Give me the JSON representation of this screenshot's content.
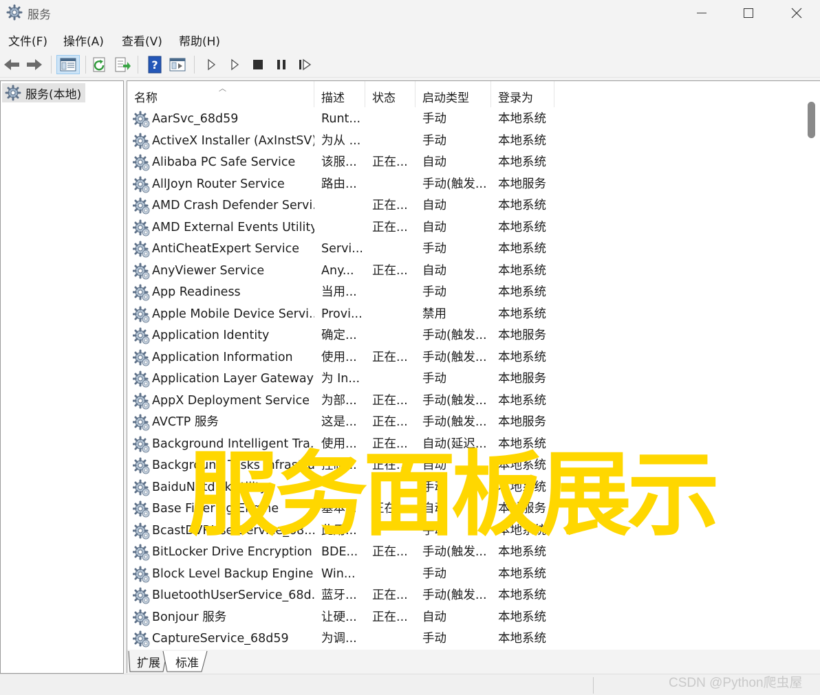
{
  "window": {
    "title": "服务",
    "icon": "gear-icon"
  },
  "menu": [
    {
      "label": "文件(F)"
    },
    {
      "label": "操作(A)"
    },
    {
      "label": "查看(V)"
    },
    {
      "label": "帮助(H)"
    }
  ],
  "toolbar": [
    {
      "name": "back-icon"
    },
    {
      "name": "forward-icon"
    },
    {
      "name": "show-hide-console-tree-icon"
    },
    {
      "name": "refresh-icon"
    },
    {
      "name": "export-list-icon"
    },
    {
      "name": "help-icon"
    },
    {
      "name": "properties-icon"
    },
    {
      "name": "start-service-icon"
    },
    {
      "name": "start-service-alt-icon"
    },
    {
      "name": "stop-service-icon"
    },
    {
      "name": "pause-service-icon"
    },
    {
      "name": "resume-service-icon"
    }
  ],
  "tree": {
    "root_label": "服务(本地)"
  },
  "columns": {
    "name": "名称",
    "description": "描述",
    "status": "状态",
    "startup_type": "启动类型",
    "logon_as": "登录为"
  },
  "services": [
    {
      "name": "AarSvc_68d59",
      "description": "Runt...",
      "status": "",
      "startup": "手动",
      "logon": "本地系统"
    },
    {
      "name": "ActiveX Installer (AxInstSV)",
      "description": "为从 ...",
      "status": "",
      "startup": "手动",
      "logon": "本地系统"
    },
    {
      "name": "Alibaba PC Safe Service",
      "description": "该服...",
      "status": "正在...",
      "startup": "自动",
      "logon": "本地系统"
    },
    {
      "name": "AllJoyn Router Service",
      "description": "路由...",
      "status": "",
      "startup": "手动(触发...",
      "logon": "本地服务"
    },
    {
      "name": "AMD Crash Defender Servi...",
      "description": "",
      "status": "正在...",
      "startup": "自动",
      "logon": "本地系统"
    },
    {
      "name": "AMD External Events Utility",
      "description": "",
      "status": "正在...",
      "startup": "自动",
      "logon": "本地系统"
    },
    {
      "name": "AntiCheatExpert Service",
      "description": "Servi...",
      "status": "",
      "startup": "手动",
      "logon": "本地系统"
    },
    {
      "name": "AnyViewer Service",
      "description": "Any...",
      "status": "正在...",
      "startup": "自动",
      "logon": "本地系统"
    },
    {
      "name": "App Readiness",
      "description": "当用...",
      "status": "",
      "startup": "手动",
      "logon": "本地系统"
    },
    {
      "name": "Apple Mobile Device Servi...",
      "description": "Provi...",
      "status": "",
      "startup": "禁用",
      "logon": "本地系统"
    },
    {
      "name": "Application Identity",
      "description": "确定...",
      "status": "",
      "startup": "手动(触发...",
      "logon": "本地服务"
    },
    {
      "name": "Application Information",
      "description": "使用...",
      "status": "正在...",
      "startup": "手动(触发...",
      "logon": "本地系统"
    },
    {
      "name": "Application Layer Gateway ...",
      "description": "为 In...",
      "status": "",
      "startup": "手动",
      "logon": "本地服务"
    },
    {
      "name": "AppX Deployment Service ...",
      "description": "为部...",
      "status": "正在...",
      "startup": "手动(触发...",
      "logon": "本地系统"
    },
    {
      "name": "AVCTP 服务",
      "description": "这是...",
      "status": "正在...",
      "startup": "手动(触发...",
      "logon": "本地服务"
    },
    {
      "name": "Background Intelligent Tra...",
      "description": "使用...",
      "status": "正在...",
      "startup": "自动(延迟...",
      "logon": "本地系统"
    },
    {
      "name": "Background Tasks Infrastru...",
      "description": "控制...",
      "status": "正在...",
      "startup": "自动",
      "logon": "本地系统"
    },
    {
      "name": "BaiduNetdiskUtility",
      "description": "",
      "status": "",
      "startup": "手动",
      "logon": "本地系统"
    },
    {
      "name": "Base Filtering Engine",
      "description": "基本...",
      "status": "正在...",
      "startup": "自动",
      "logon": "本地服务"
    },
    {
      "name": "BcastDVRUserService_68...",
      "description": "此用...",
      "status": "",
      "startup": "手动",
      "logon": "本地系统"
    },
    {
      "name": "BitLocker Drive Encryption ...",
      "description": "BDE...",
      "status": "正在...",
      "startup": "手动(触发...",
      "logon": "本地系统"
    },
    {
      "name": "Block Level Backup Engine ...",
      "description": "Win...",
      "status": "",
      "startup": "手动",
      "logon": "本地系统"
    },
    {
      "name": "BluetoothUserService_68d...",
      "description": "蓝牙...",
      "status": "正在...",
      "startup": "手动(触发...",
      "logon": "本地系统"
    },
    {
      "name": "Bonjour 服务",
      "description": "让硬...",
      "status": "正在...",
      "startup": "自动",
      "logon": "本地系统"
    },
    {
      "name": "CaptureService_68d59",
      "description": "为调...",
      "status": "",
      "startup": "手动",
      "logon": "本地系统"
    }
  ],
  "tabs": [
    {
      "label": "扩展"
    },
    {
      "label": "标准"
    }
  ],
  "overlay": {
    "caption": "服务面板展示",
    "color": "#ffd700"
  },
  "watermark": "CSDN @Python爬虫屋"
}
